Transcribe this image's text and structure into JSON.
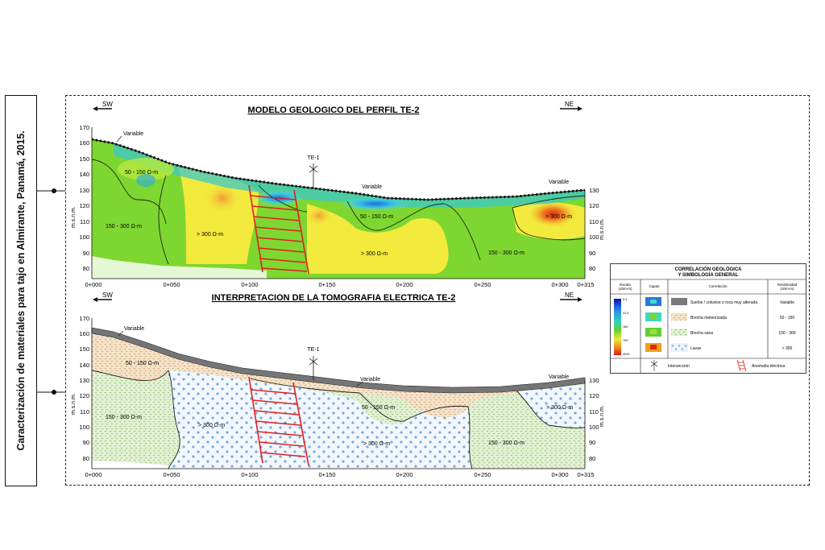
{
  "side_title": "Caracterización de materiales para tajo en Almirante, Panamá, 2015.",
  "directions": {
    "left": "SW",
    "right": "NE"
  },
  "top_panel": {
    "title": "MODELO GEOLOGICO DEL PERFIL TE-2",
    "axis_y_label": "m.s.n.m.",
    "y_ticks_left": [
      "170",
      "160",
      "150",
      "140",
      "130",
      "120",
      "110",
      "100",
      "90",
      "80"
    ],
    "y_ticks_right": [
      "130",
      "120",
      "110",
      "100",
      "90",
      "80"
    ],
    "x_ticks": [
      "0+000",
      "0+050",
      "0+100",
      "0+150",
      "0+200",
      "0+250",
      "0+300",
      "0+315"
    ],
    "marker": "TE-1",
    "labels": {
      "variable_1": "Variable",
      "variable_2": "Variable",
      "variable_3": "Variable",
      "r50_150": "50 - 150 Ω-m",
      "r50_150_b": "50 - 150 Ω-m",
      "r150_300_left": "150 - 300 Ω-m",
      "r150_300_right": "150 - 300 Ω-m",
      "r300_a": "> 300 Ω-m",
      "r300_b": "> 300 Ω-m",
      "r300_c": "> 300 Ω-m"
    }
  },
  "bottom_panel": {
    "title": "INTERPRETACION DE LA TOMOGRAFIA ELECTRICA TE-2",
    "axis_y_label": "m.s.n.m.",
    "y_ticks_left": [
      "170",
      "160",
      "150",
      "140",
      "130",
      "120",
      "110",
      "100",
      "90",
      "80"
    ],
    "y_ticks_right": [
      "130",
      "120",
      "110",
      "100",
      "90",
      "80"
    ],
    "x_ticks": [
      "0+000",
      "0+050",
      "0+100",
      "0+150",
      "0+200",
      "0+250",
      "0+300",
      "0+315"
    ],
    "marker": "TE-1",
    "labels": {
      "variable_1": "Variable",
      "variable_2": "Variable",
      "variable_3": "Variable",
      "r50_150": "50 - 150 Ω-m",
      "r50_150_b": "50 - 150 Ω-m",
      "r150_300_left": "150 - 300 Ω-m",
      "r150_300_right": "150 - 300 Ω-m",
      "r300_a": "> 300 Ω-m",
      "r300_b": "> 300 Ω-m",
      "r300_c": "> 300 Ω-m"
    }
  },
  "legend": {
    "title_1": "CORRELACIÓN GEOLÓGICA",
    "title_2": "Y SIMBOLOGÍA GENERAL",
    "headers": {
      "escala": "Escala",
      "escala_unit": "(ohm-m)",
      "capas": "Capas",
      "correlacion": "Correlación",
      "resistividad": "Resistividad",
      "resistividad_unit": "(ohm-m)"
    },
    "scale_ticks": [
      "8.4",
      "31.9",
      "166",
      "799",
      "4000"
    ],
    "rows": [
      {
        "name": "Suelos / coluvios o roca muy alterada",
        "value": "Variable"
      },
      {
        "name": "Brecha meteorizada",
        "value": "50 - 150"
      },
      {
        "name": "Brecha sana",
        "value": "150 - 300"
      },
      {
        "name": "Lavas",
        "value": "> 300"
      }
    ],
    "symbols": {
      "intersection": "Intersección",
      "anomaly": "Anomalía eléctrica"
    }
  },
  "colors": {
    "soil": "#7a7a7a",
    "breccia_weathered": "#f3dcc0",
    "breccia_sound": "#d9ecc8",
    "lava": "#eaf3fb",
    "anomaly": "#e02020",
    "tomo_green": "#78d22c",
    "tomo_yellow": "#f0ea3a",
    "tomo_orange": "#f0a020",
    "tomo_blue": "#3aa0e8"
  }
}
